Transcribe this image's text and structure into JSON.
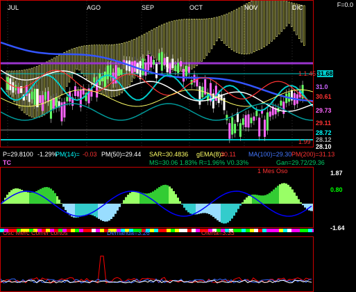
{
  "header": {
    "frame_label": "F=0.0"
  },
  "price_axis": {
    "months": [
      "JUL",
      "AGO",
      "SEP",
      "OCT",
      "NOV",
      "DIC"
    ],
    "labels": [
      {
        "text": "31.68",
        "color": "#00ffff",
        "hl": true
      },
      {
        "text": "31.0",
        "color": "#cc66ff"
      },
      {
        "text": "30.61",
        "color": "#ff3333"
      },
      {
        "text": "29.73",
        "color": "#ff66ff"
      },
      {
        "text": "29.11",
        "color": "#ff3333"
      },
      {
        "text": "28.72",
        "color": "#00ffff"
      },
      {
        "text": "28.12",
        "color": "#aaaaaa"
      },
      {
        "text": "28.10",
        "color": "#ffffff"
      }
    ],
    "tags": [
      "1.1.45",
      "1.99"
    ]
  },
  "indicators": {
    "price": "P=29.8100",
    "change": "-1.29%",
    "pm14": "PM(14)=",
    "pm14_val": "-0.03",
    "pm50": "PM(50)=29.44",
    "sar": "SAR=30.4836",
    "gema": "gEMA(8)=",
    "gema_val": "30.11",
    "ma": "MA(100)=29.30",
    "pm200": "PM(200)=31.13",
    "tc": "TC",
    "ms": "MS=30.06 1.83% R=1.96% V0.33%",
    "gan": "Gan=29.72/29.36"
  },
  "oscillator": {
    "label": "1 Mes Oso",
    "top": "1.87",
    "mid": "0.80",
    "bottom": "-1.64"
  },
  "bottom_bar": {
    "osc_label": "Osc Merc Correr cortos",
    "demanda": "Demanda=3.26",
    "oferta": "Oferta=3.33"
  },
  "colors": {
    "border": "#cc0000",
    "band": "#ffff66",
    "grid": "#ffffff"
  }
}
